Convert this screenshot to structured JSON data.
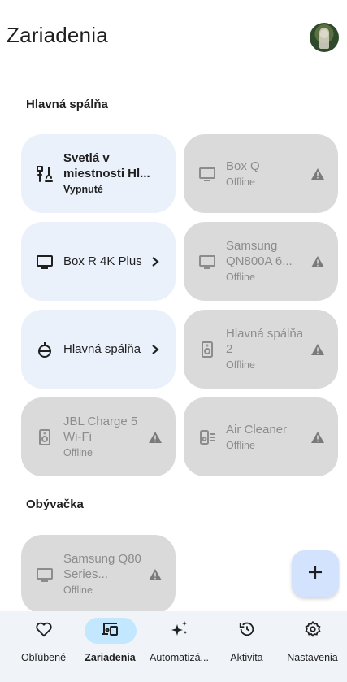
{
  "header": {
    "title": "Zariadenia"
  },
  "sections": [
    {
      "title": "Hlavná spálňa"
    },
    {
      "title": "Obývačka"
    }
  ],
  "devices": [
    {
      "name": "Svetlá v miestnosti Hl...",
      "status": "Vypnuté",
      "state": "active",
      "icon": "lights-icon",
      "trail": ""
    },
    {
      "name": "Box Q",
      "status": "Offline",
      "state": "offline",
      "icon": "tv-icon",
      "trail": "warning-icon"
    },
    {
      "name": "Box R 4K Plus",
      "status": "",
      "state": "active",
      "icon": "tv-icon",
      "trail": "chevron-right-icon"
    },
    {
      "name": "Samsung QN800A 6...",
      "status": "Offline",
      "state": "offline",
      "icon": "tv-icon",
      "trail": "warning-icon"
    },
    {
      "name": "Hlavná spálňa",
      "status": "",
      "state": "active",
      "icon": "speaker-group-icon",
      "trail": "chevron-right-icon"
    },
    {
      "name": "Hlavná spálňa 2",
      "status": "Offline",
      "state": "offline",
      "icon": "speaker-icon",
      "trail": "warning-icon"
    },
    {
      "name": "JBL Charge 5 Wi-Fi",
      "status": "Offline",
      "state": "offline",
      "icon": "speaker-icon",
      "trail": "warning-icon"
    },
    {
      "name": "Air Cleaner",
      "status": "Offline",
      "state": "offline",
      "icon": "air-purifier-icon",
      "trail": "warning-icon"
    },
    {
      "name": "Samsung Q80 Series...",
      "status": "Offline",
      "state": "offline",
      "icon": "tv-icon",
      "trail": "warning-icon"
    }
  ],
  "fab": {
    "icon": "plus-icon"
  },
  "nav": [
    {
      "label": "Obľúbené",
      "icon": "heart-icon",
      "selected": false
    },
    {
      "label": "Zariadenia",
      "icon": "devices-icon",
      "selected": true
    },
    {
      "label": "Automatizá...",
      "icon": "sparkle-icon",
      "selected": false
    },
    {
      "label": "Aktivita",
      "icon": "history-icon",
      "selected": false
    },
    {
      "label": "Nastavenia",
      "icon": "gear-icon",
      "selected": false
    }
  ],
  "colors": {
    "accent": "#c2e7ff",
    "active_card": "#eaf1fb",
    "offline_card": "#dadada",
    "fab": "#d3e3fd",
    "navbar": "#f0f4f9"
  }
}
